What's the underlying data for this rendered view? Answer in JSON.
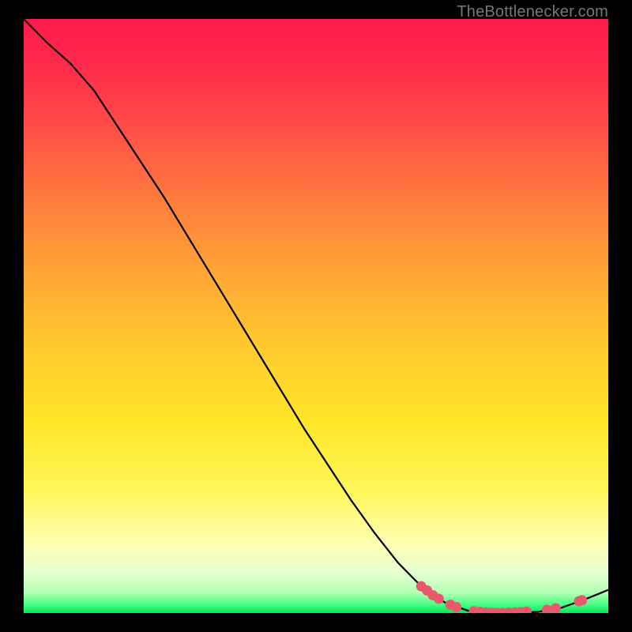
{
  "watermark": "TheBottlenecker.com",
  "chart_data": {
    "type": "line",
    "title": "",
    "xlabel": "",
    "ylabel": "",
    "xlim": [
      0,
      100
    ],
    "ylim": [
      0,
      100
    ],
    "grid": false,
    "legend": false,
    "background_gradient": [
      "#ff1744",
      "#ff5252",
      "#ff8a50",
      "#ffab40",
      "#ffd740",
      "#ffee58",
      "#fff176",
      "#fff59d",
      "#f0f4c3",
      "#dcedc8",
      "#00e676"
    ],
    "series": [
      {
        "name": "curve",
        "color": "#000000",
        "x": [
          0,
          4,
          8,
          12,
          16,
          20,
          24,
          28,
          32,
          36,
          40,
          44,
          48,
          52,
          56,
          60,
          64,
          68,
          72,
          76,
          80,
          84,
          88,
          92,
          96,
          100
        ],
        "y": [
          100,
          96,
          92.5,
          88,
          82,
          76,
          70,
          63.5,
          57,
          50.5,
          44,
          37.5,
          31,
          25,
          19,
          13.5,
          8.5,
          4.5,
          1.8,
          0.4,
          0,
          0,
          0.2,
          0.9,
          2.3,
          3.9
        ]
      }
    ],
    "markers": {
      "color": "#e85a6b",
      "points": [
        {
          "x": 68,
          "y": 4.5
        },
        {
          "x": 69,
          "y": 3.8
        },
        {
          "x": 70,
          "y": 3.0
        },
        {
          "x": 71,
          "y": 2.4
        },
        {
          "x": 73,
          "y": 1.4
        },
        {
          "x": 74,
          "y": 1.0
        },
        {
          "x": 77,
          "y": 0.3
        },
        {
          "x": 78,
          "y": 0.2
        },
        {
          "x": 79,
          "y": 0.1
        },
        {
          "x": 80,
          "y": 0.05
        },
        {
          "x": 81,
          "y": 0.02
        },
        {
          "x": 82,
          "y": 0.02
        },
        {
          "x": 83,
          "y": 0.05
        },
        {
          "x": 84,
          "y": 0.1
        },
        {
          "x": 85,
          "y": 0.15
        },
        {
          "x": 86,
          "y": 0.25
        },
        {
          "x": 89.5,
          "y": 0.55
        },
        {
          "x": 91,
          "y": 0.8
        },
        {
          "x": 95,
          "y": 2.0
        },
        {
          "x": 95.5,
          "y": 2.15
        }
      ]
    }
  }
}
